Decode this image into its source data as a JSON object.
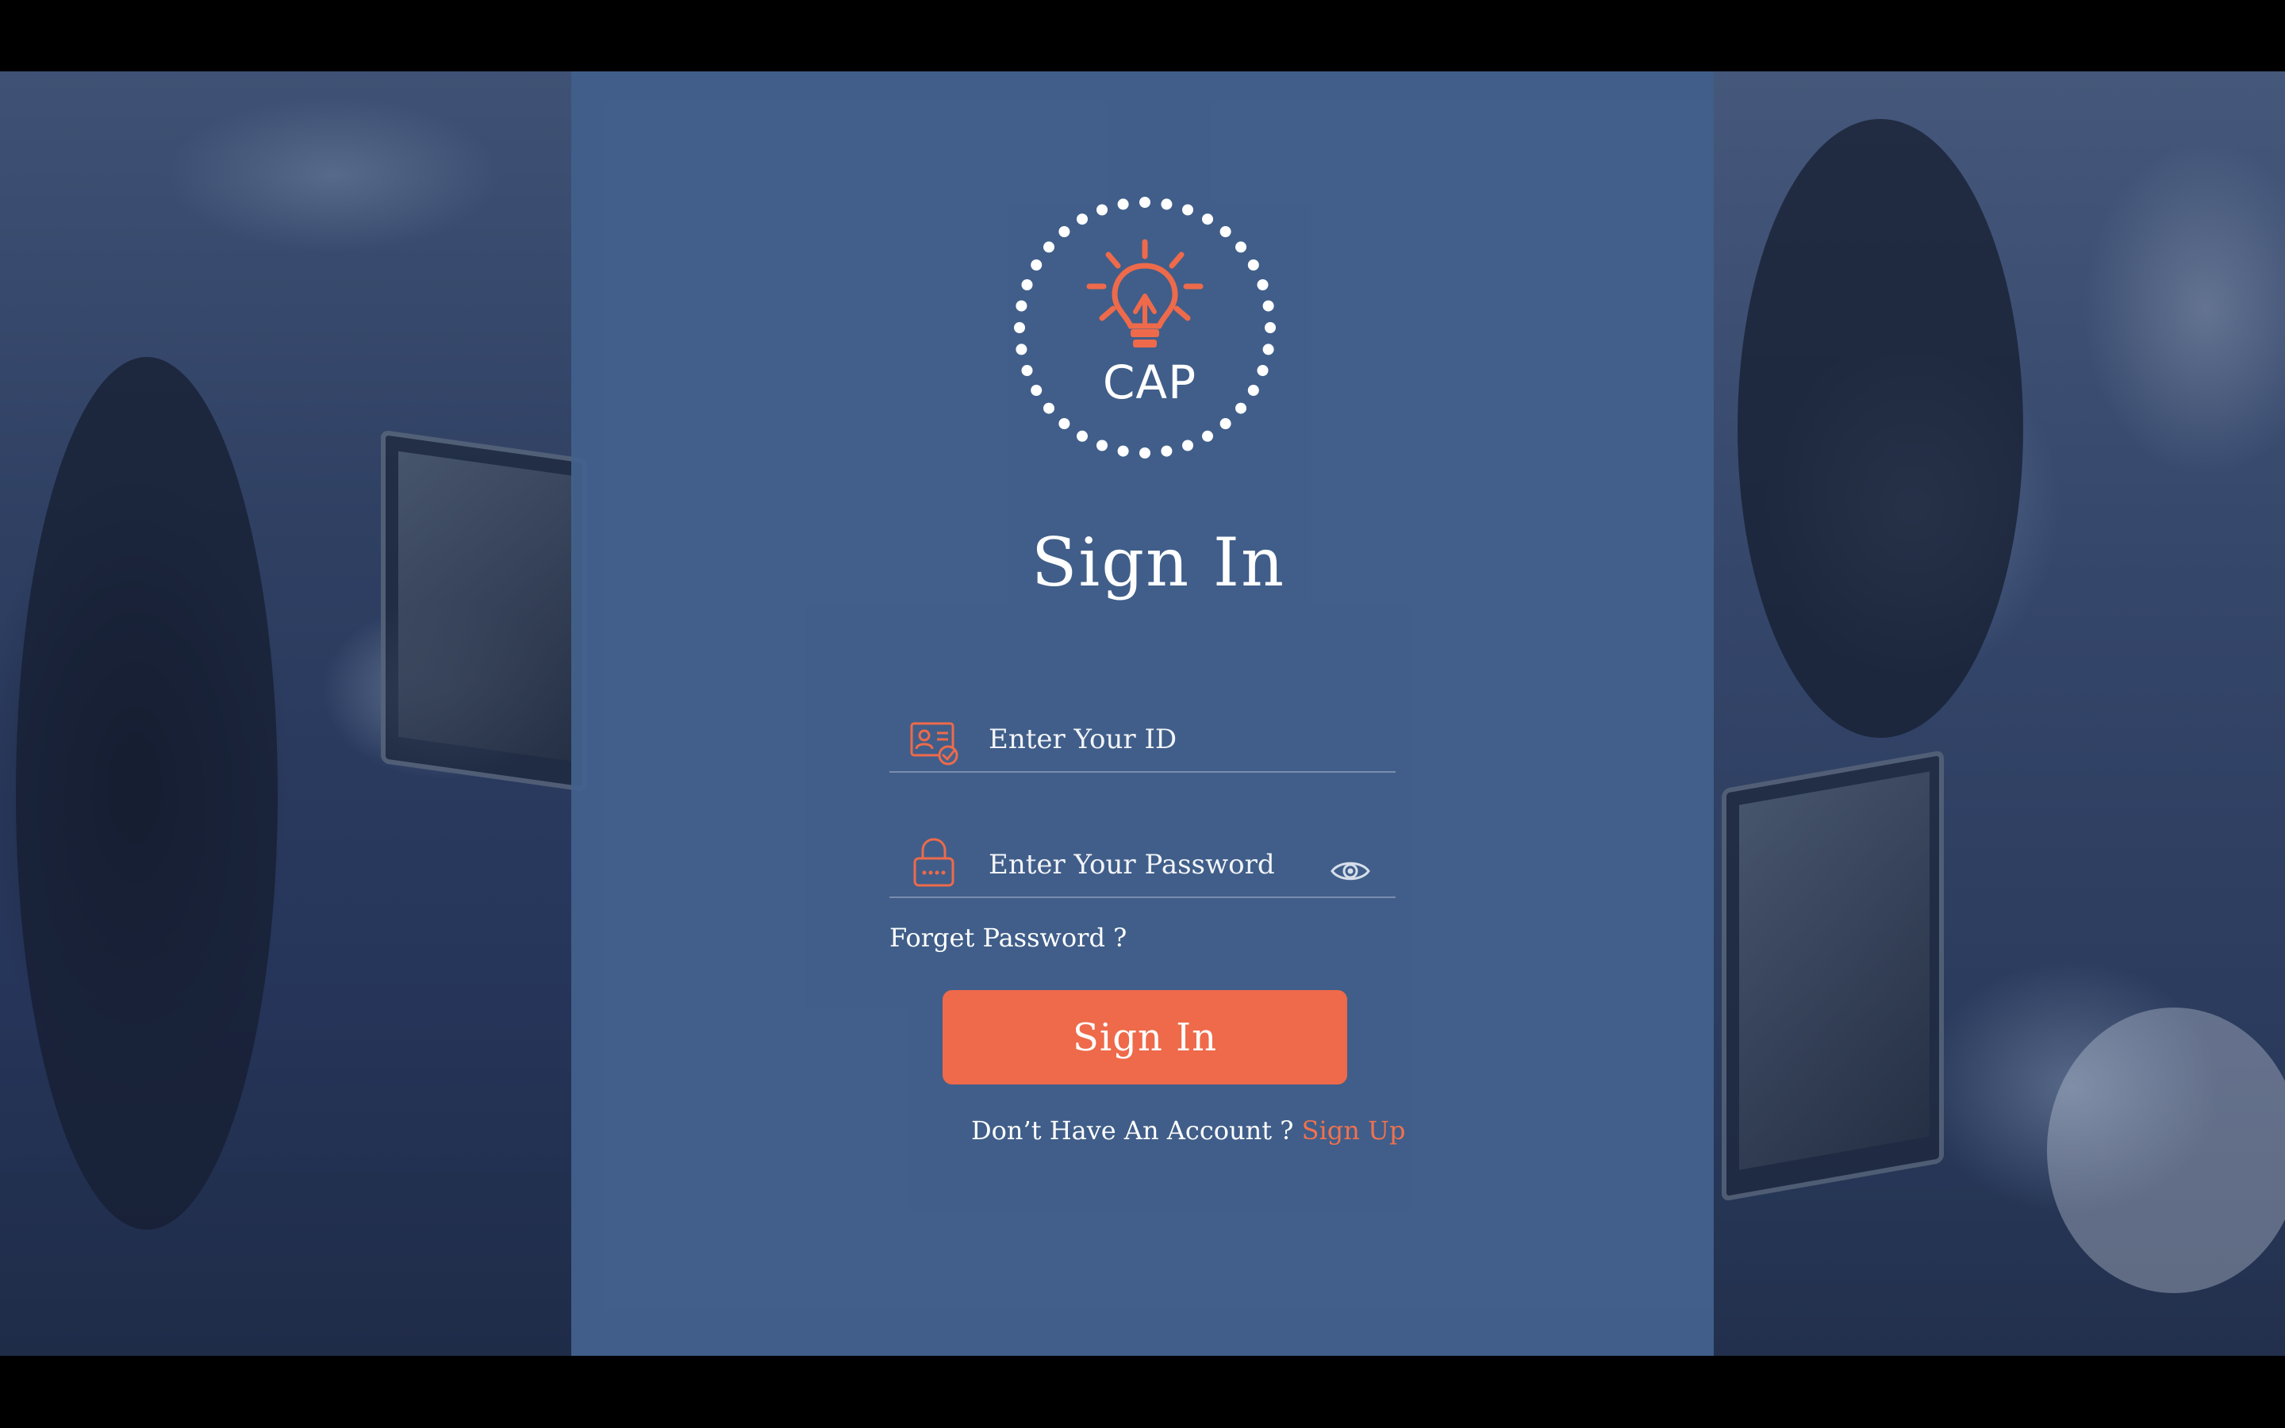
{
  "brand": {
    "logo_text": "CAP"
  },
  "title": "Sign In",
  "form": {
    "id_placeholder": "Enter Your ID",
    "password_placeholder": "Enter Your Password",
    "forgot_label": "Forget Password ?",
    "submit_label": "Sign In",
    "no_account_text": "Don’t Have An Account ?",
    "signup_label": "Sign Up"
  },
  "icons": {
    "logo": "lightbulb-icon",
    "id": "id-card-icon",
    "password": "lock-icon",
    "show_password": "eye-icon"
  },
  "colors": {
    "panel": "#43628e",
    "accent": "#ee6a4a",
    "text": "#ffffff"
  }
}
